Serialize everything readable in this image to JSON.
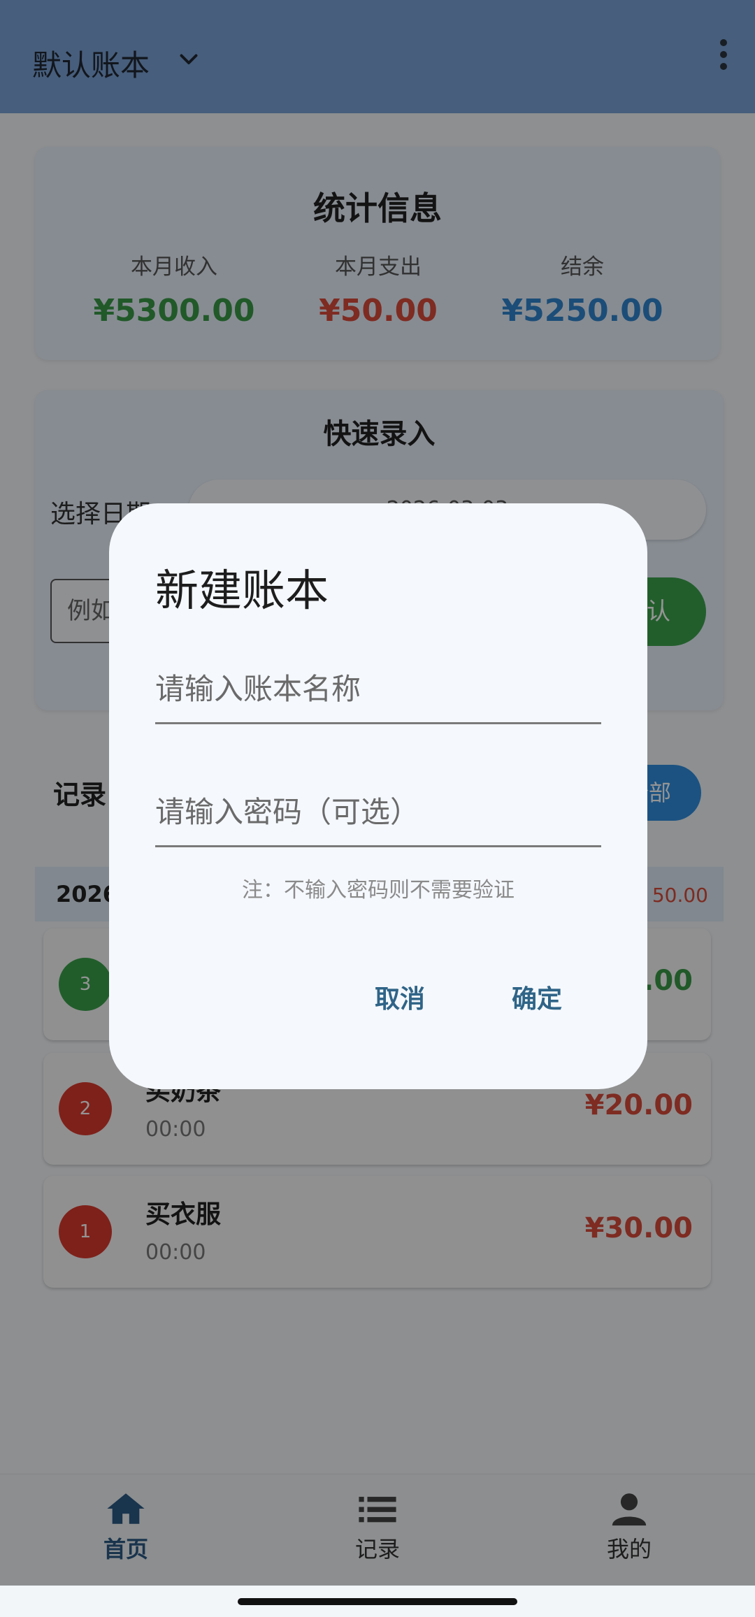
{
  "appbar": {
    "title": "默认账本"
  },
  "stats": {
    "heading": "统计信息",
    "income_label": "本月收入",
    "income_value": "¥5300.00",
    "income_color": "#3a9a48",
    "expense_label": "本月支出",
    "expense_value": "¥50.00",
    "expense_color": "#d94a3b",
    "balance_label": "结余",
    "balance_value": "¥5250.00",
    "balance_color": "#2f86cf"
  },
  "quick": {
    "heading": "快速录入",
    "date_label": "选择日期",
    "date_value": "2026-03-03",
    "desc_placeholder": "例如",
    "confirm_label": "确认"
  },
  "records": {
    "heading": "记录",
    "all_button": "全部",
    "day_label": "2026",
    "day_sum": "50.00",
    "items": [
      {
        "badge": "3",
        "badge_color": "#3aa14b",
        "name": "",
        "time": "",
        "amount": ".00",
        "amount_color": "#3a9a48"
      },
      {
        "badge": "2",
        "badge_color": "#d9392e",
        "name": "买奶茶",
        "time": "00:00",
        "amount": "¥20.00",
        "amount_color": "#d94a3b"
      },
      {
        "badge": "1",
        "badge_color": "#d9392e",
        "name": "买衣服",
        "time": "00:00",
        "amount": "¥30.00",
        "amount_color": "#d94a3b"
      }
    ]
  },
  "nav": {
    "home": "首页",
    "records": "记录",
    "mine": "我的"
  },
  "dialog": {
    "title": "新建账本",
    "name_placeholder": "请输入账本名称",
    "password_placeholder": "请输入密码（可选）",
    "note": "注：不输入密码则不需要验证",
    "cancel": "取消",
    "ok": "确定"
  }
}
